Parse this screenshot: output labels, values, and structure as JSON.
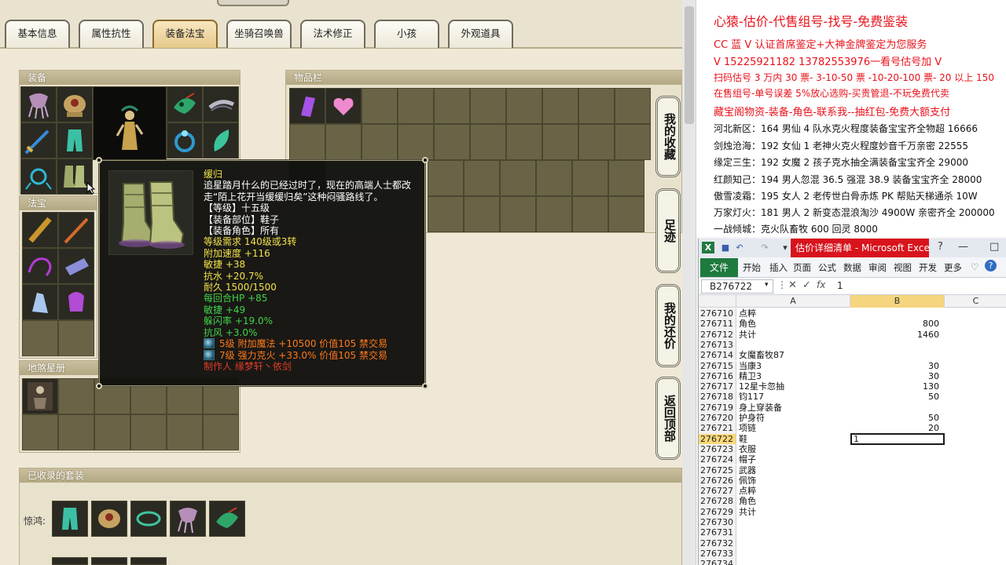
{
  "game": {
    "tabs": [
      "基本信息",
      "属性抗性",
      "装备法宝",
      "坐骑召唤兽",
      "法术修正",
      "小孩",
      "外观道具"
    ],
    "active_tab": 2,
    "panels": {
      "equip": "装备",
      "items": "物品栏",
      "treasure": "法宝",
      "stars": "地煞星册",
      "suits": "已收录的套装"
    },
    "side_buttons": [
      "我的收藏",
      "足迹",
      "我的还价",
      "返回顶部"
    ],
    "suit_label": "惊鸿:",
    "tooltip": {
      "name": "缓归",
      "desc1": "追星踏月什么的已经过时了，现在的高端人士都改",
      "desc2": "走“陌上花开当缓缓归矣”这种闷骚路线了。",
      "level": "【等级】十五级",
      "slot": "【装备部位】鞋子",
      "role": "【装备角色】所有",
      "req": "等级需求 140级或3转",
      "speed": "附加速度 +116",
      "agi1": "敏捷 +38",
      "water": "抗水 +20.7%",
      "durability": "耐久 1500/1500",
      "hp_regen": "每回合HP +85",
      "agi2": "敏捷 +49",
      "dodge": "躲闪率 +19.0%",
      "wind": "抗风 +3.0%",
      "gem1": "5级 附加魔法 +10500 价值105 禁交易",
      "gem2": "7级 强力克火 +33.0% 价值105 禁交易",
      "maker": "制作人 缘梦轩丶依剑"
    }
  },
  "doc": {
    "lines": [
      "心猿-估价-代售组号-找号-免费鉴装",
      "CC 蓝 V 认证首席鉴定+大神金牌鉴定为您服务",
      "V 15225921182      13782553976一看号估号加 V",
      "扫码估号 3 万内 30 票- 3-10-50 票  -10-20-100 票- 20 以上 150",
      "在售组号-单号误差 5%放心选购-买贵管退-不玩免费代卖",
      "藏宝阁物资-装备-角色-联系我--抽红包-免费大额支付",
      "河北新区：164 男仙 4 队水克火程度装备宝宝齐全物超 16666",
      "剑烛沧海：192 女仙 1 老神火克火程度妙音千万亲密 22555",
      "缘定三生：192 女魔 2 孩子克水抽全满装备宝宝齐全 29000",
      "红颜知己：194 男人忽混 36.5 强混 38.9 装备宝宝齐全 28000",
      "傲雪凌霜：195 女人 2 老传世白骨赤炼 PK 帮贴天梯通杀 10W",
      "万家灯火：181 男人 2 新变态混浪淘沙 4900W 亲密齐全 200000",
      "一战倾城：克火队畜牧 600 回灵 8000"
    ]
  },
  "excel": {
    "title": "估价详细清单 - Microsoft Excel...",
    "ribbon_tabs": [
      "文件",
      "开始",
      "插入",
      "页面",
      "公式",
      "数据",
      "审阅",
      "视图",
      "开发",
      "更多"
    ],
    "name_box": "B276722",
    "formula_value": "1",
    "columns": [
      "A",
      "B",
      "C"
    ],
    "rows": [
      {
        "n": "276710",
        "a": "点粹",
        "b": ""
      },
      {
        "n": "276711",
        "a": "角色",
        "b": "800"
      },
      {
        "n": "276712",
        "a": "共计",
        "b": "1460"
      },
      {
        "n": "276713",
        "a": "",
        "b": ""
      },
      {
        "n": "276714",
        "a": "女魔畜牧87",
        "b": ""
      },
      {
        "n": "276715",
        "a": "当康3",
        "b": "30"
      },
      {
        "n": "276716",
        "a": "精卫3",
        "b": "30"
      },
      {
        "n": "276717",
        "a": "12星卡忽抽",
        "b": "130"
      },
      {
        "n": "276718",
        "a": "钧117",
        "b": "50"
      },
      {
        "n": "276719",
        "a": "身上穿装备",
        "b": ""
      },
      {
        "n": "276720",
        "a": "护身符",
        "b": "50"
      },
      {
        "n": "276721",
        "a": "项链",
        "b": "20"
      },
      {
        "n": "276722",
        "a": "鞋",
        "b": "1"
      },
      {
        "n": "276723",
        "a": "衣服",
        "b": ""
      },
      {
        "n": "276724",
        "a": "帽子",
        "b": ""
      },
      {
        "n": "276725",
        "a": "武器",
        "b": ""
      },
      {
        "n": "276726",
        "a": "佩饰",
        "b": ""
      },
      {
        "n": "276727",
        "a": "点粹",
        "b": ""
      },
      {
        "n": "276728",
        "a": "角色",
        "b": ""
      },
      {
        "n": "276729",
        "a": "共计",
        "b": ""
      },
      {
        "n": "276730",
        "a": "",
        "b": ""
      },
      {
        "n": "276731",
        "a": "",
        "b": ""
      },
      {
        "n": "276732",
        "a": "",
        "b": ""
      },
      {
        "n": "276733",
        "a": "",
        "b": ""
      },
      {
        "n": "276734",
        "a": "",
        "b": ""
      }
    ],
    "selected_row": "276722"
  }
}
